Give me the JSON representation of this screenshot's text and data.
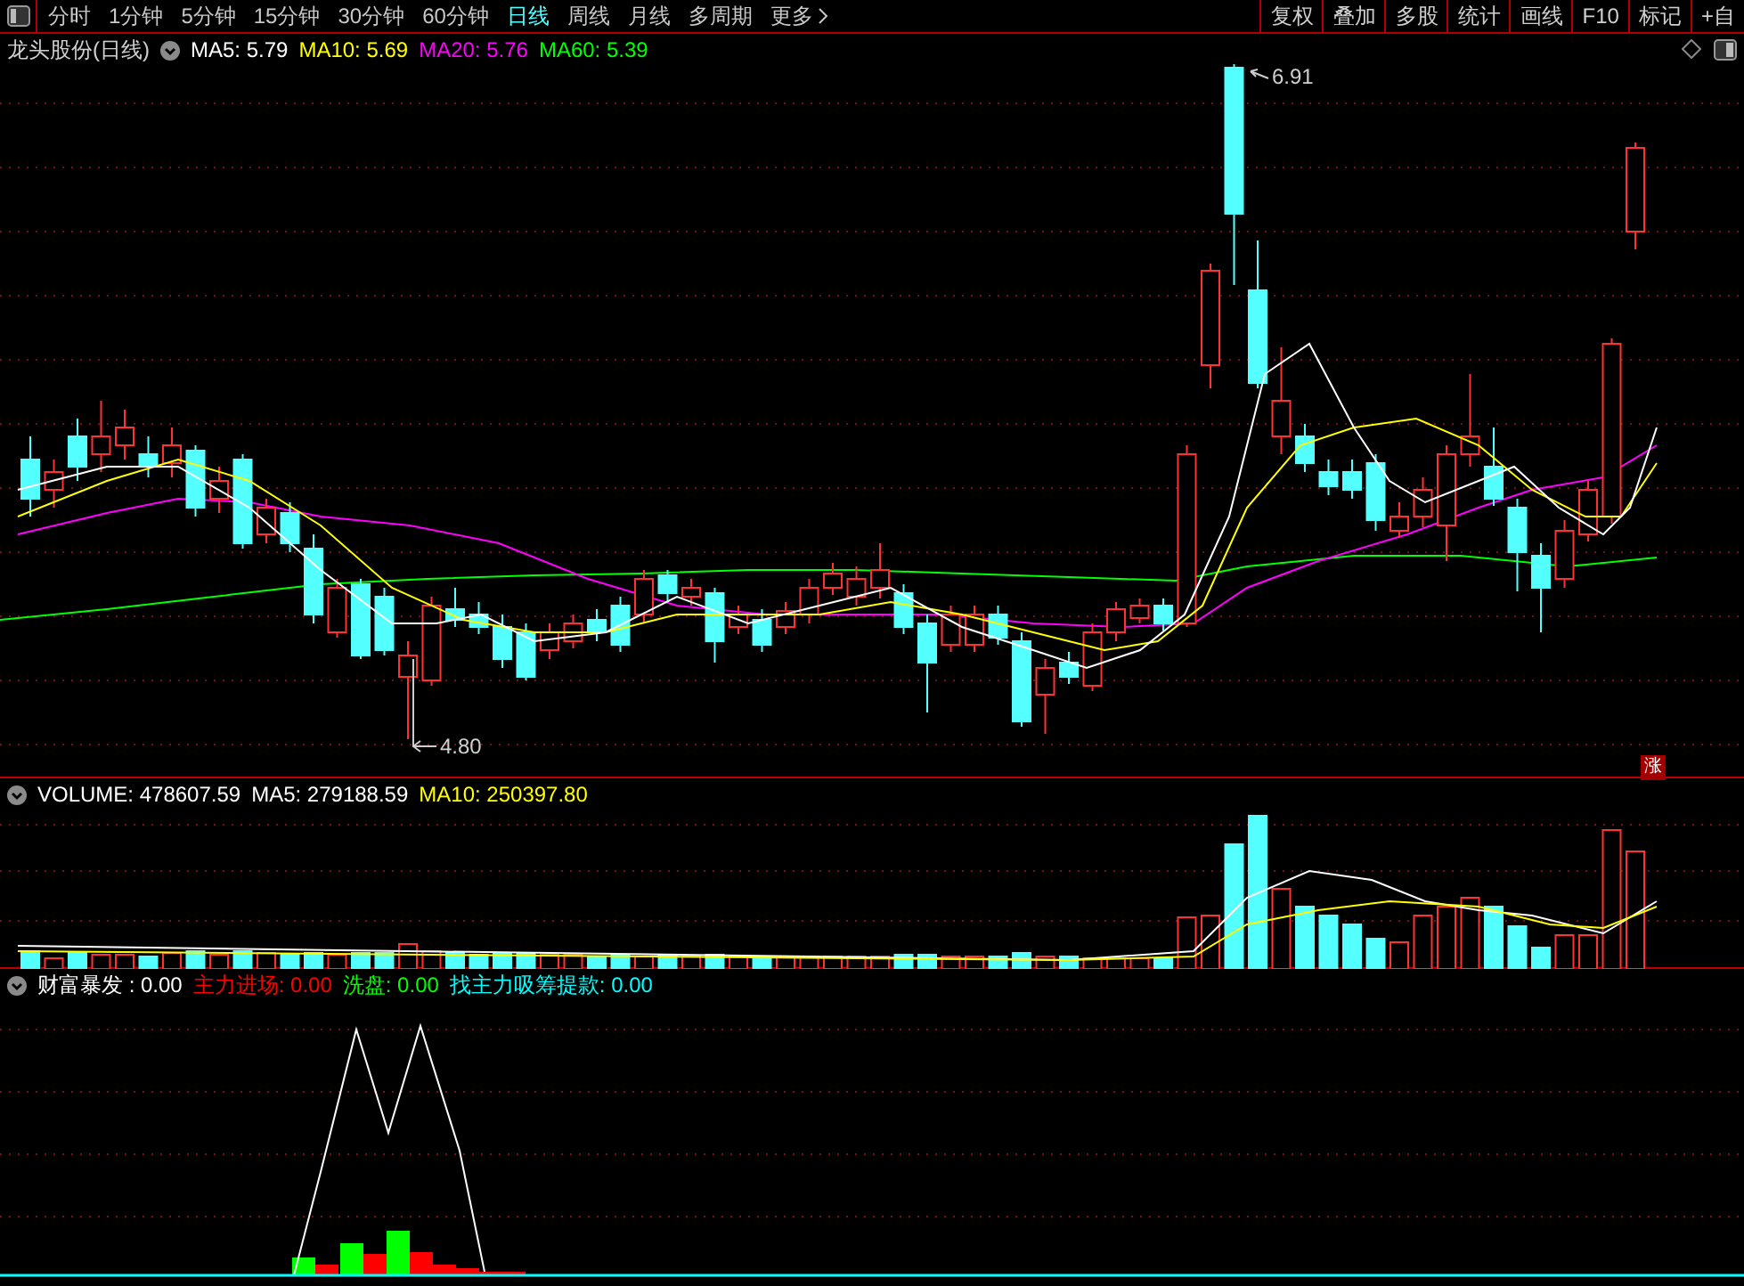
{
  "toolbar": {
    "periods": [
      {
        "label": "分时",
        "selected": false
      },
      {
        "label": "1分钟",
        "selected": false
      },
      {
        "label": "5分钟",
        "selected": false
      },
      {
        "label": "15分钟",
        "selected": false
      },
      {
        "label": "30分钟",
        "selected": false
      },
      {
        "label": "60分钟",
        "selected": false
      },
      {
        "label": "日线",
        "selected": true
      },
      {
        "label": "周线",
        "selected": false
      },
      {
        "label": "月线",
        "selected": false
      },
      {
        "label": "多周期",
        "selected": false
      }
    ],
    "more": "更多",
    "buttons": [
      "复权",
      "叠加",
      "多股",
      "统计",
      "画线",
      "F10",
      "标记",
      "+自"
    ]
  },
  "main_chart": {
    "title": "龙头股份(日线)",
    "indicators": [
      {
        "label": "MA5: 5.79",
        "color": "#ffffff"
      },
      {
        "label": "MA10: 5.69",
        "color": "#ffff00"
      },
      {
        "label": "MA20: 5.76",
        "color": "#ff00ff"
      },
      {
        "label": "MA60: 5.39",
        "color": "#00ff00"
      }
    ],
    "high_label": "6.91",
    "low_label": "4.80",
    "badge": "涨"
  },
  "volume_panel": {
    "indicators": [
      {
        "label": "VOLUME: 478607.59",
        "color": "#ffffff"
      },
      {
        "label": "MA5: 279188.59",
        "color": "#ffffff"
      },
      {
        "label": "MA10: 250397.80",
        "color": "#ffff00"
      }
    ]
  },
  "indicator_panel": {
    "indicators": [
      {
        "label": "财富暴发  : 0.00",
        "color": "#ffffff"
      },
      {
        "label": "主力进场: 0.00",
        "color": "#ff0000"
      },
      {
        "label": "洗盘: 0.00",
        "color": "#00ff00"
      },
      {
        "label": "找主力吸筹提款: 0.00",
        "color": "#00ffff"
      }
    ]
  }
}
